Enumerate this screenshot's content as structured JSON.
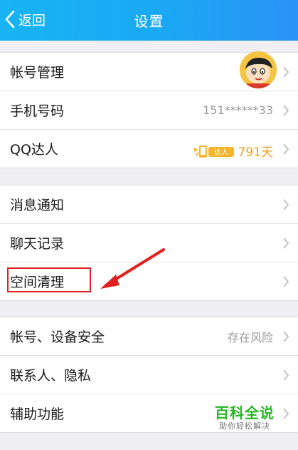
{
  "header": {
    "back_label": "返回",
    "title": "设置"
  },
  "groups": [
    [
      {
        "label": "帐号管理",
        "value": ""
      },
      {
        "label": "手机号码",
        "value": "151******33"
      },
      {
        "label": "QQ达人",
        "value": "791天",
        "badge": "达人"
      }
    ],
    [
      {
        "label": "消息通知",
        "value": ""
      },
      {
        "label": "聊天记录",
        "value": ""
      },
      {
        "label": "空间清理",
        "value": ""
      }
    ],
    [
      {
        "label": "帐号、设备安全",
        "value": "存在风险"
      },
      {
        "label": "联系人、隐私",
        "value": ""
      },
      {
        "label": "辅助功能",
        "value": ""
      }
    ]
  ],
  "watermark": {
    "title": "百科全说",
    "subtitle": "助你轻松解决"
  },
  "colors": {
    "header": "#1aa8f4",
    "accent_red": "#e02020",
    "daren_orange": "#f0a020",
    "watermark_green": "#25b820"
  }
}
